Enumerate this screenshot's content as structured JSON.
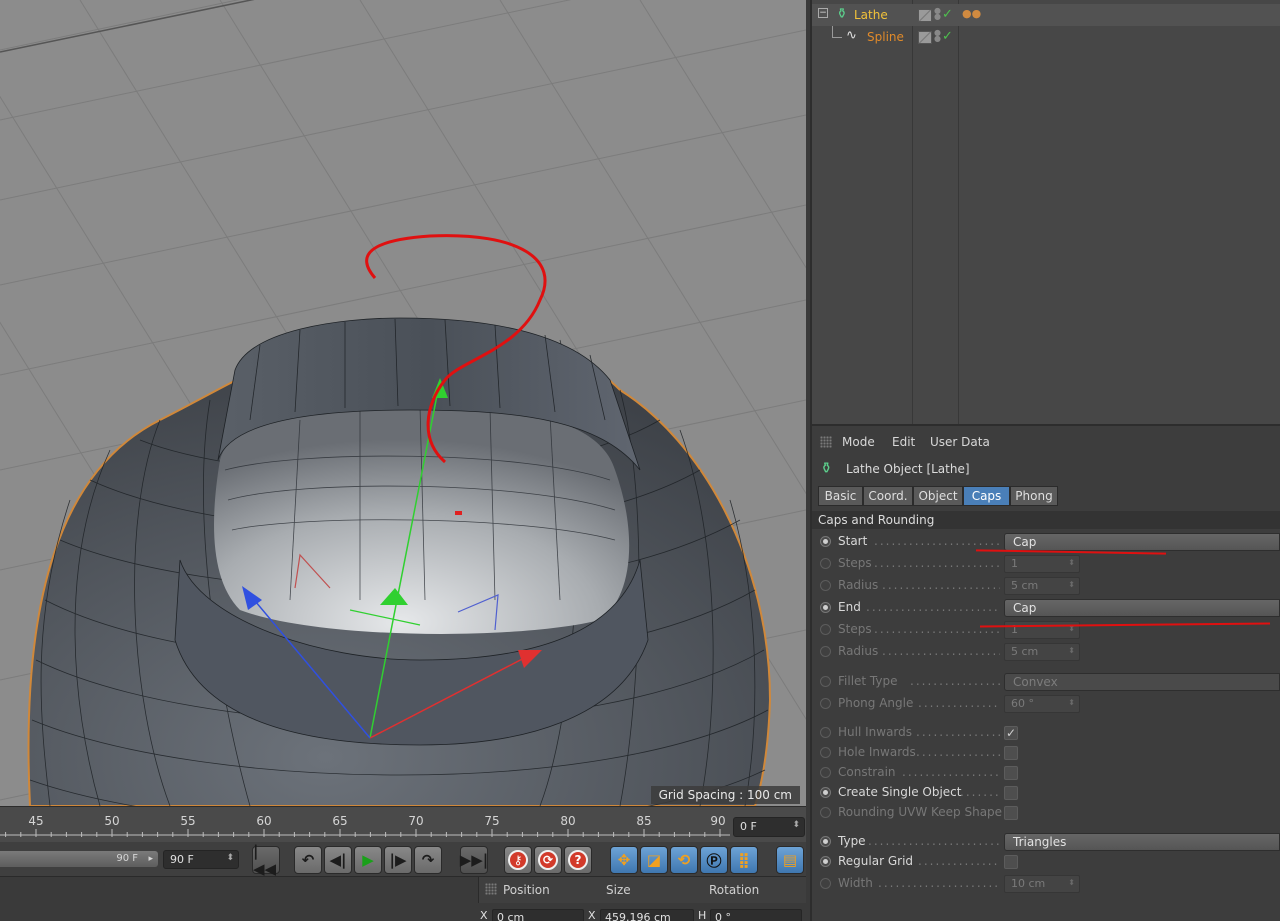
{
  "viewport": {
    "grid_spacing": "Grid Spacing : 100 cm"
  },
  "timeline": {
    "ticks": [
      "45",
      "50",
      "55",
      "60",
      "65",
      "70",
      "75",
      "80",
      "85",
      "90"
    ],
    "current_frame": "0 F",
    "range_end_slider": "90 F",
    "end_frame": "90 F"
  },
  "coordinates": {
    "headers": {
      "position": "Position",
      "size": "Size",
      "rotation": "Rotation"
    },
    "row_x": {
      "pos_axis": "X",
      "pos_value": "0 cm",
      "size_axis": "X",
      "size_value": "459.196 cm",
      "rot_axis": "H",
      "rot_value": "0 °"
    }
  },
  "object_manager": {
    "objects": [
      {
        "name": "Lathe",
        "icon": "lathe-icon"
      },
      {
        "name": "Spline",
        "icon": "spline-icon"
      }
    ]
  },
  "attributes": {
    "menu": {
      "mode": "Mode",
      "edit": "Edit",
      "user_data": "User Data"
    },
    "title": "Lathe Object [Lathe]",
    "tabs": [
      "Basic",
      "Coord.",
      "Object",
      "Caps",
      "Phong"
    ],
    "active_tab": "Caps",
    "section": "Caps and Rounding",
    "start": {
      "label": "Start",
      "value": "Cap"
    },
    "start_steps": {
      "label": "Steps",
      "value": "1"
    },
    "start_radius": {
      "label": "Radius",
      "value": "5 cm"
    },
    "end": {
      "label": "End",
      "value": "Cap"
    },
    "end_steps": {
      "label": "Steps",
      "value": "1"
    },
    "end_radius": {
      "label": "Radius",
      "value": "5 cm"
    },
    "fillet_type": {
      "label": "Fillet Type",
      "value": "Convex"
    },
    "phong_angle": {
      "label": "Phong Angle",
      "value": "60 °"
    },
    "hull_inwards": {
      "label": "Hull Inwards",
      "check": "✓"
    },
    "hole_inwards": {
      "label": "Hole Inwards"
    },
    "constrain": {
      "label": "Constrain"
    },
    "create_single": {
      "label": "Create Single Object"
    },
    "rounding_uvw": {
      "label": "Rounding UVW Keep Shape"
    },
    "type": {
      "label": "Type",
      "value": "Triangles"
    },
    "regular_grid": {
      "label": "Regular Grid"
    },
    "width": {
      "label": "Width",
      "value": "10 cm"
    }
  },
  "colors": {
    "active_tab": "#4a7fb8",
    "lathe_label": "#f2c23a",
    "spline_label": "#e08a2a",
    "annotation": "#e01010"
  }
}
